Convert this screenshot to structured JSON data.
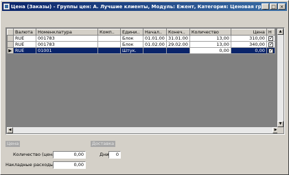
{
  "window": {
    "title": "Цена (Заказы) - Группы цен: А. Лучшие клиенты, Модуль: Ежент, Категория: Ценовая группа",
    "min_label": "_",
    "max_label": "□",
    "close_label": "×"
  },
  "grid": {
    "columns": [
      "Валюта",
      "Номенклатура",
      "Комп..",
      "Едини..",
      "Начал..",
      "Конеч..",
      "Количество",
      "Цена",
      "Н"
    ],
    "rows": [
      {
        "currency": "RUE",
        "item": "001783",
        "comp": "",
        "unit": "Блок",
        "start": "01.01.00",
        "end": "31.01.00",
        "qty": "13,00",
        "price": "310,00",
        "flag": true
      },
      {
        "currency": "RUE",
        "item": "001783",
        "comp": "",
        "unit": "Блок",
        "start": "01.02.00",
        "end": "29.02.00",
        "qty": "13,00",
        "price": "340,00",
        "flag": true
      },
      {
        "currency": "RUE",
        "item": "01001",
        "comp": "",
        "unit": "Штук.",
        "start": "",
        "end": "",
        "qty": "0,00",
        "price": "0,00",
        "flag": true
      }
    ],
    "current_row_marker": "▶"
  },
  "price_group": {
    "label": "Цена",
    "quantity_label": "Количество (цена)",
    "quantity_value": "0,00",
    "overhead_label": "Накладные расходы",
    "overhead_value": "0,00"
  },
  "delivery_group": {
    "label": "Доставка",
    "days_label": "Дни",
    "days_value": "0"
  }
}
